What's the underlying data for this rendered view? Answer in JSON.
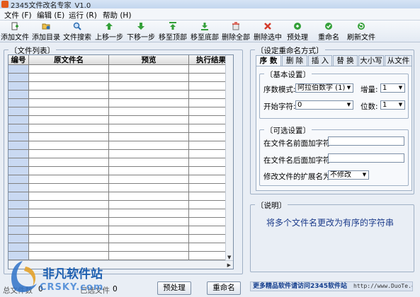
{
  "window": {
    "title": "2345文件改名专家_V1.0"
  },
  "menu": {
    "items": [
      "文件 (F)",
      "编辑 (E)",
      "运行 (R)",
      "帮助 (H)"
    ]
  },
  "toolbar": {
    "items": [
      {
        "label": "添加文件",
        "icon": "add-file-icon",
        "color": "#3a7a3a"
      },
      {
        "label": "添加目录",
        "icon": "add-folder-icon",
        "color": "#2f6fb1"
      },
      {
        "label": "文件搜索",
        "icon": "file-search-icon",
        "color": "#2f6fb1"
      },
      {
        "label": "上移一步",
        "icon": "arrow-up-icon",
        "color": "#35a03a"
      },
      {
        "label": "下移一步",
        "icon": "arrow-down-icon",
        "color": "#35a03a"
      },
      {
        "label": "移至顶部",
        "icon": "move-top-icon",
        "color": "#35a03a"
      },
      {
        "label": "移至底部",
        "icon": "move-bottom-icon",
        "color": "#35a03a"
      },
      {
        "label": "删除全部",
        "icon": "delete-all-icon",
        "color": "#d43b2b"
      },
      {
        "label": "删除选中",
        "icon": "delete-selected-icon",
        "color": "#d43b2b"
      },
      {
        "label": "预处理",
        "icon": "preprocess-icon",
        "color": "#35a03a"
      },
      {
        "label": "重命名",
        "icon": "rename-icon",
        "color": "#35a03a"
      },
      {
        "label": "刷新文件",
        "icon": "refresh-icon",
        "color": "#35a03a"
      }
    ]
  },
  "file_list": {
    "title": "文件列表",
    "columns": [
      "编号",
      "原文件名",
      "预览",
      "执行结果"
    ]
  },
  "rename_settings": {
    "title": "设定重命名方式",
    "tabs": [
      "序 数",
      "删 除",
      "插 入",
      "替 换",
      "大小写",
      "从文件"
    ],
    "basic": {
      "title": "基本设置",
      "seq_mode_label": "序数模式:",
      "seq_mode_value": "阿拉伯数字 (1)",
      "increment_label": "增量:",
      "increment_value": "1",
      "start_label": "开始字符:",
      "start_value": "0",
      "digits_label": "位数:",
      "digits_value": "1"
    },
    "optional": {
      "title": "可选设置",
      "prefix_label": "在文件名前面加字符:",
      "suffix_label": "在文件名后面加字符:",
      "ext_label": "修改文件的扩展名为:",
      "ext_value": "不修改"
    }
  },
  "description": {
    "title": "说明",
    "text": "将多个文件名更改为有序的字符串"
  },
  "bottom": {
    "total_label": "总文件数",
    "total_value": "0",
    "selected_label": "已选文件",
    "selected_value": "0",
    "preprocess_label": "预处理",
    "rename_label": "重命名",
    "promo_text": "更多精品软件请访问2345软件站",
    "promo_url": "http://www.DuoTe.com"
  },
  "watermark": {
    "brand": "非凡软件站",
    "sub": "CRSKY.com"
  }
}
